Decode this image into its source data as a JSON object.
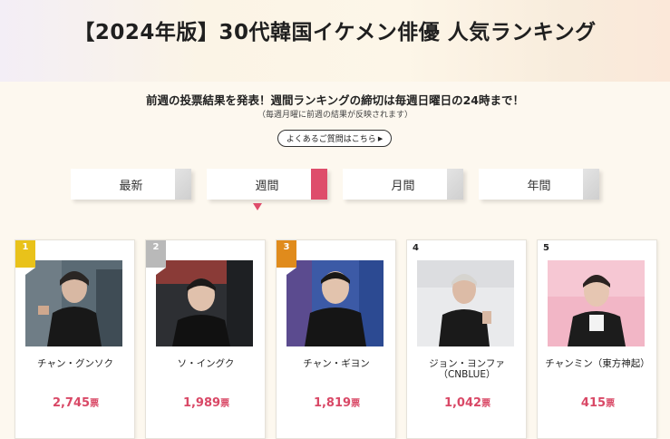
{
  "title": "【2024年版】30代韓国イケメン俳優 人気ランキング",
  "notice": "前週の投票結果を発表！週間ランキングの締切は毎週日曜日の24時まで！",
  "subnotice": "（毎週月曜に前週の結果が反映されます）",
  "faq_label": "よくあるご質問はこちら",
  "tabs": [
    {
      "label": "最新",
      "active": false
    },
    {
      "label": "週間",
      "active": true
    },
    {
      "label": "月間",
      "active": false
    },
    {
      "label": "年間",
      "active": false
    }
  ],
  "vote_unit": "票",
  "colors": {
    "accent": "#de4d6b",
    "vote": "#d94866",
    "gold": "#e9c21a",
    "silver": "#b9b9b9",
    "bronze": "#e08b1c"
  },
  "ranking": [
    {
      "rank": "1",
      "name": "チャン・グンソク",
      "votes": "2,745"
    },
    {
      "rank": "2",
      "name": "ソ・イングク",
      "votes": "1,989"
    },
    {
      "rank": "3",
      "name": "チャン・ギヨン",
      "votes": "1,819"
    },
    {
      "rank": "4",
      "name": "ジョン・ヨンファ（CNBLUE）",
      "votes": "1,042"
    },
    {
      "rank": "5",
      "name": "チャンミン（東方神起）",
      "votes": "415"
    }
  ]
}
